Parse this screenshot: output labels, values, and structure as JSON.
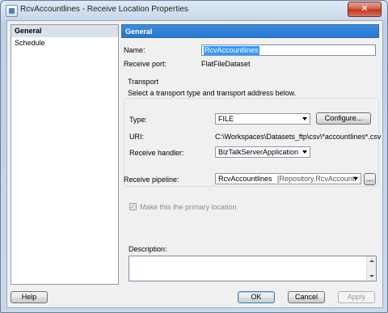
{
  "window": {
    "title": "RcvAccountlines - Receive Location Properties",
    "close_glyph": "✕"
  },
  "nav": {
    "items": [
      {
        "label": "General",
        "selected": true
      },
      {
        "label": "Schedule",
        "selected": false
      }
    ]
  },
  "general": {
    "header": "General",
    "name_label": "Name:",
    "name_value": "RcvAccountlines",
    "receive_port_label": "Receive port:",
    "receive_port_value": "FlatFileDataset"
  },
  "transport": {
    "group_label": "Transport",
    "instruction": "Select a transport type and transport address below.",
    "type_label": "Type:",
    "type_value": "FILE",
    "configure_label": "Configure...",
    "uri_label": "URI:",
    "uri_value": "C:\\Workspaces\\Datasets_ftp\\csv\\*accountlines*.csv",
    "handler_label": "Receive handler:",
    "handler_value": "BizTalkServerApplication"
  },
  "pipeline": {
    "label": "Receive pipeline:",
    "value": "RcvAccountlines",
    "assembly": "[Repository.RcvAccountl",
    "browse_label": "..."
  },
  "primary": {
    "label": "Make this the primary location",
    "checked": true,
    "check_glyph": "✓"
  },
  "description": {
    "label": "Description:",
    "value": ""
  },
  "footer": {
    "help_label": "Help",
    "ok_label": "OK",
    "cancel_label": "Cancel",
    "apply_label": "Apply"
  }
}
